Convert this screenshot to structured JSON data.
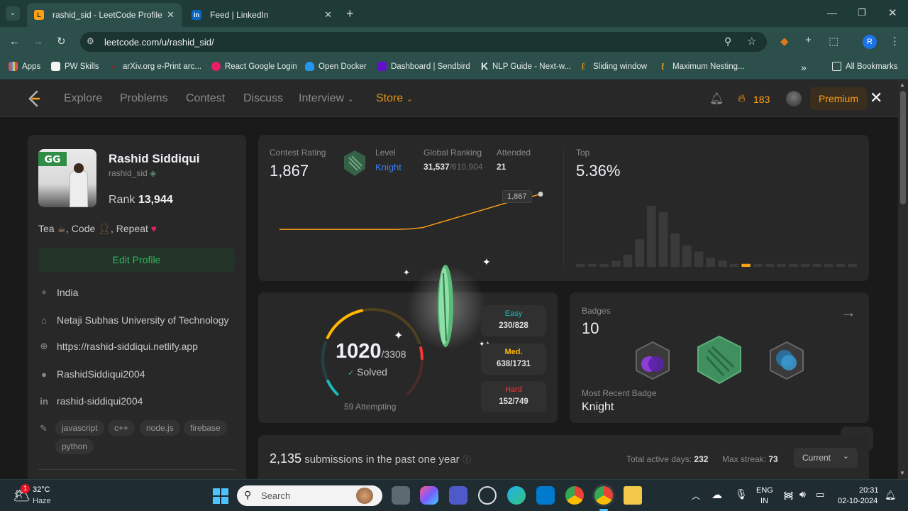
{
  "browser": {
    "tabs": [
      {
        "title": "rashid_sid - LeetCode Profile",
        "active": true
      },
      {
        "title": "Feed | LinkedIn",
        "active": false
      }
    ],
    "url": "leetcode.com/u/rashid_sid/",
    "bookmarks": [
      "Apps",
      "PW Skills",
      "arXiv.org e-Print arc...",
      "React Google Login",
      "Open Docker",
      "Dashboard | Sendbird",
      "NLP Guide - Next-w...",
      "Sliding window",
      "Maximum Nesting..."
    ],
    "all_bookmarks": "All Bookmarks",
    "profile_initial": "R"
  },
  "nav": {
    "links": [
      "Explore",
      "Problems",
      "Contest",
      "Discuss",
      "Interview",
      "Store"
    ],
    "streak": "183",
    "premium": "Premium"
  },
  "profile": {
    "name": "Rashid Siddiqui",
    "username": "rashid_sid",
    "rank_label": "Rank",
    "rank_value": "13,944",
    "bio_parts": [
      "Tea",
      ", Code",
      ", Repeat"
    ],
    "edit_button": "Edit Profile",
    "location": "India",
    "university": "Netaji Subhas University of Technology",
    "website": "https://rashid-siddiqui.netlify.app",
    "github": "RashidSiddiqui2004",
    "linkedin": "rashid-siddiqui2004",
    "skills": [
      "javascript",
      "c++",
      "node.js",
      "firebase",
      "python"
    ]
  },
  "contest": {
    "rating_label": "Contest Rating",
    "rating": "1,867",
    "level_label": "Level",
    "level": "Knight",
    "global_label": "Global Ranking",
    "global_rank": "31,537",
    "global_total": "/610,904",
    "attended_label": "Attended",
    "attended": "21",
    "top_label": "Top",
    "top": "5.36%",
    "tooltip": "1,867"
  },
  "chart_data": {
    "type": "line",
    "series": [
      {
        "values": [
          1500,
          1500,
          1500,
          1500,
          1500,
          1500,
          1500,
          1500,
          1500,
          1500,
          1505,
          1520,
          1560,
          1600,
          1640,
          1680,
          1720,
          1760,
          1800,
          1830,
          1867
        ]
      }
    ],
    "histogram": [
      1,
      1,
      1,
      2,
      4,
      9,
      20,
      18,
      11,
      7,
      5,
      3,
      2,
      1,
      1,
      1,
      1,
      1,
      1,
      1,
      1,
      1,
      1,
      1
    ],
    "highlight_index": 14
  },
  "solved": {
    "count": "1020",
    "total": "/3308",
    "label": "Solved",
    "attempting": "59 Attempting",
    "easy_label": "Easy",
    "easy": "230/828",
    "med_label": "Med.",
    "med": "638/1731",
    "hard_label": "Hard",
    "hard": "152/749",
    "easy_frac": 0.278,
    "med_frac": 0.369,
    "hard_frac": 0.203,
    "colors": {
      "easy": "#1cbaba",
      "med": "#ffb700",
      "hard": "#f63737"
    }
  },
  "badges": {
    "label": "Badges",
    "count": "10",
    "recent_label": "Most Recent Badge",
    "recent": "Knight"
  },
  "submissions": {
    "count": "2,135",
    "text": "submissions in the past one year",
    "active_label": "Total active days:",
    "active_value": "232",
    "streak_label": "Max streak:",
    "streak_value": "73",
    "dropdown": "Current"
  },
  "taskbar": {
    "weather_temp": "32°C",
    "weather_text": "Haze",
    "search": "Search",
    "lang1": "ENG",
    "lang2": "IN",
    "time": "20:31",
    "date": "02-10-2024",
    "notif_badge": "1"
  }
}
